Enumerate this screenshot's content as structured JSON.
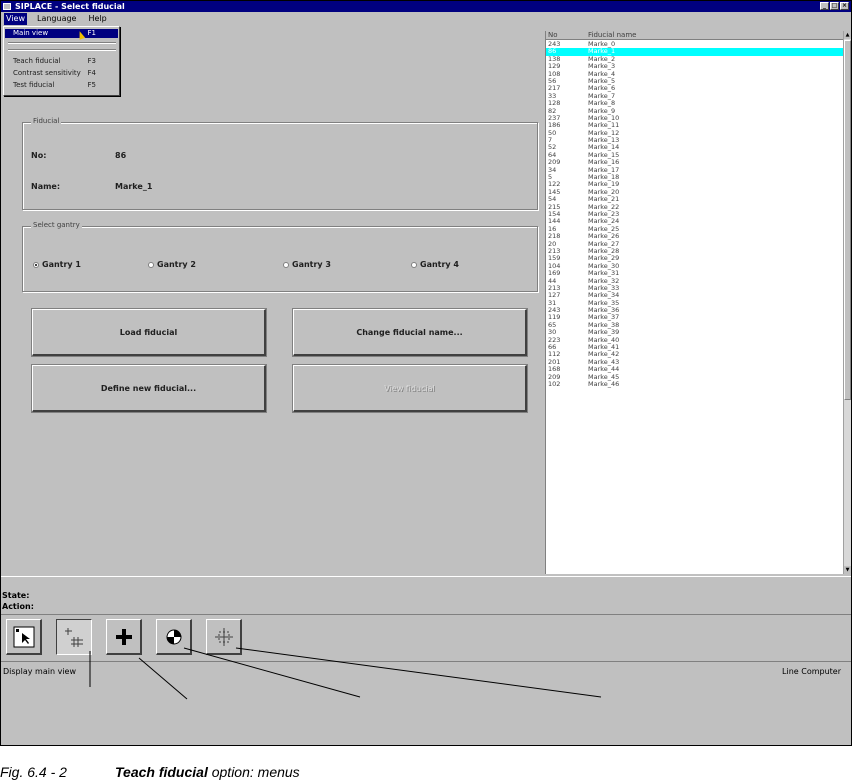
{
  "window": {
    "title": "SIPLACE - Select fiducial",
    "controls": [
      "_",
      "□",
      "×"
    ]
  },
  "menubar": [
    "View",
    "Language",
    "Help"
  ],
  "view_menu": {
    "items": [
      {
        "label": "Main view",
        "key": "F1"
      },
      {
        "label": "Teach fiducial",
        "key": "F3"
      },
      {
        "label": "Contrast sensitivity",
        "key": "F4"
      },
      {
        "label": "Test fiducial",
        "key": "F5"
      }
    ]
  },
  "fiducial_group": {
    "caption": "Fiducial",
    "no_label": "No:",
    "no_value": "86",
    "name_label": "Name:",
    "name_value": "Marke_1"
  },
  "gantry_group": {
    "caption": "Select gantry",
    "options": [
      {
        "label": "Gantry 1",
        "selected": true
      },
      {
        "label": "Gantry 2",
        "selected": false
      },
      {
        "label": "Gantry 3",
        "selected": false
      },
      {
        "label": "Gantry 4",
        "selected": false
      }
    ]
  },
  "buttons": {
    "load": "Load fiducial",
    "change_name": "Change fiducial name...",
    "define_new": "Define new fiducial...",
    "view": "View fiducial"
  },
  "fiducial_list": {
    "headers": [
      "No",
      "Fiducial name"
    ],
    "selected_index": 1,
    "rows": [
      [
        "243",
        "Marke_0"
      ],
      [
        "86",
        "Marke_1"
      ],
      [
        "138",
        "Marke_2"
      ],
      [
        "129",
        "Marke_3"
      ],
      [
        "108",
        "Marke_4"
      ],
      [
        "56",
        "Marke_5"
      ],
      [
        "217",
        "Marke_6"
      ],
      [
        "33",
        "Marke_7"
      ],
      [
        "128",
        "Marke_8"
      ],
      [
        "82",
        "Marke_9"
      ],
      [
        "237",
        "Marke_10"
      ],
      [
        "186",
        "Marke_11"
      ],
      [
        "50",
        "Marke_12"
      ],
      [
        "7",
        "Marke_13"
      ],
      [
        "52",
        "Marke_14"
      ],
      [
        "64",
        "Marke_15"
      ],
      [
        "209",
        "Marke_16"
      ],
      [
        "34",
        "Marke_17"
      ],
      [
        "5",
        "Marke_18"
      ],
      [
        "122",
        "Marke_19"
      ],
      [
        "145",
        "Marke_20"
      ],
      [
        "54",
        "Marke_21"
      ],
      [
        "215",
        "Marke_22"
      ],
      [
        "154",
        "Marke_23"
      ],
      [
        "144",
        "Marke_24"
      ],
      [
        "16",
        "Marke_25"
      ],
      [
        "218",
        "Marke_26"
      ],
      [
        "20",
        "Marke_27"
      ],
      [
        "213",
        "Marke_28"
      ],
      [
        "159",
        "Marke_29"
      ],
      [
        "104",
        "Marke_30"
      ],
      [
        "169",
        "Marke_31"
      ],
      [
        "44",
        "Marke_32"
      ],
      [
        "213",
        "Marke_33"
      ],
      [
        "127",
        "Marke_34"
      ],
      [
        "31",
        "Marke_35"
      ],
      [
        "243",
        "Marke_36"
      ],
      [
        "119",
        "Marke_37"
      ],
      [
        "65",
        "Marke_38"
      ],
      [
        "30",
        "Marke_39"
      ],
      [
        "223",
        "Marke_40"
      ],
      [
        "66",
        "Marke_41"
      ],
      [
        "112",
        "Marke_42"
      ],
      [
        "201",
        "Marke_43"
      ],
      [
        "168",
        "Marke_44"
      ],
      [
        "209",
        "Marke_45"
      ],
      [
        "102",
        "Marke_46"
      ]
    ]
  },
  "status": {
    "state_label": "State:",
    "action_label": "Action:"
  },
  "toolbar_icons": [
    "pointer-icon",
    "fiducial-grid-icon",
    "crosshair-icon",
    "contrast-icon",
    "target-icon"
  ],
  "statusbar": {
    "left": "Display main view",
    "right": "Line Computer"
  },
  "caption": {
    "number": "Fig. 6.4 - 2",
    "bold": "Teach fiducial",
    "rest": " option: menus"
  }
}
